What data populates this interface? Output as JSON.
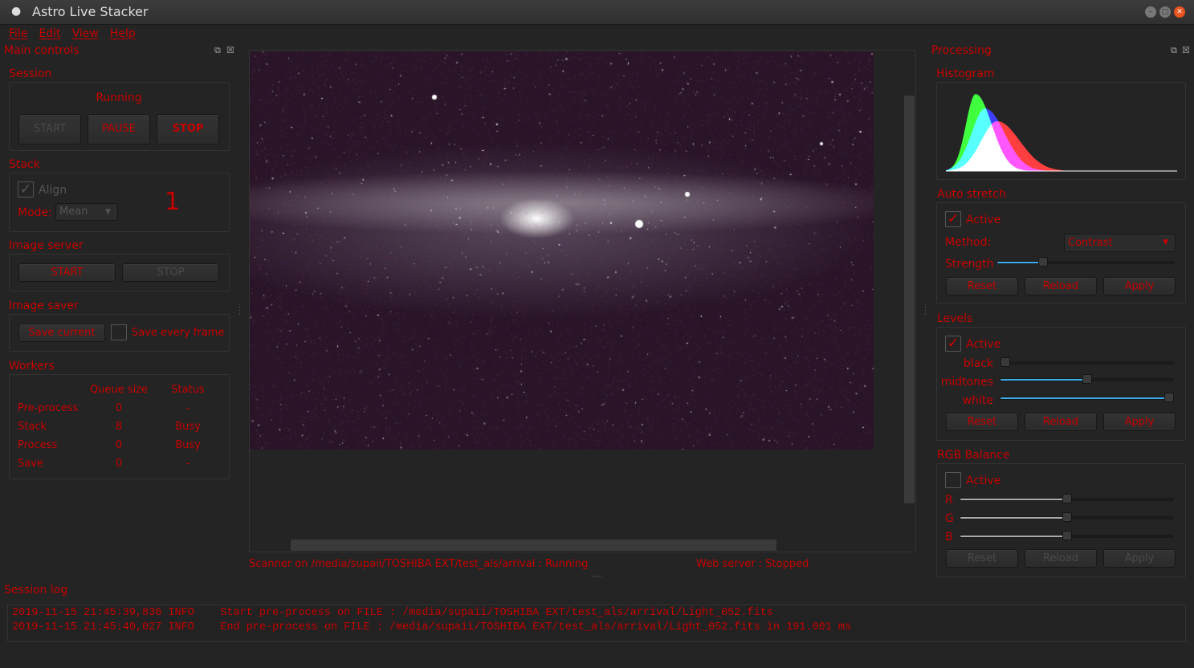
{
  "window": {
    "title": "Astro Live Stacker"
  },
  "menu": [
    "File",
    "Edit",
    "View",
    "Help"
  ],
  "main_controls": {
    "title": "Main controls",
    "session": {
      "label": "Session",
      "status": "Running",
      "start": "START",
      "pause": "PAUSE",
      "stop": "STOP"
    },
    "stack": {
      "label": "Stack",
      "align_label": "Align",
      "align_checked": true,
      "mode_label": "Mode:",
      "mode_value": "Mean",
      "count": "1"
    },
    "image_server": {
      "label": "Image server",
      "start": "START",
      "stop": "STOP"
    },
    "image_saver": {
      "label": "Image saver",
      "save_current": "Save current",
      "save_every_frame": "Save every frame",
      "save_every_frame_checked": false
    },
    "workers": {
      "label": "Workers",
      "headers": [
        "Queue size",
        "Status"
      ],
      "rows": [
        {
          "name": "Pre-process",
          "queue": "0",
          "status": "-"
        },
        {
          "name": "Stack",
          "queue": "8",
          "status": "Busy"
        },
        {
          "name": "Process",
          "queue": "0",
          "status": "Busy"
        },
        {
          "name": "Save",
          "queue": "0",
          "status": "-"
        }
      ]
    }
  },
  "status": {
    "scanner": "Scanner on /media/supaii/TOSHIBA EXT/test_als/arrival : Running",
    "web_server": "Web server : Stopped"
  },
  "processing": {
    "title": "Processing",
    "histogram": {
      "label": "Histogram",
      "channel_colors": {
        "r": "#ff2020",
        "g": "#20ff20",
        "b": "#2020ff"
      }
    },
    "auto_stretch": {
      "label": "Auto stretch",
      "active_label": "Active",
      "active": true,
      "method_label": "Method:",
      "method_value": "Contrast",
      "strength_label": "Strength",
      "strength": 0.26,
      "reset": "Reset",
      "reload": "Reload",
      "apply": "Apply"
    },
    "levels": {
      "label": "Levels",
      "active_label": "Active",
      "active": true,
      "black_label": "black",
      "black": 0.0,
      "midtones_label": "midtones",
      "midtones": 0.5,
      "white_label": "white",
      "white": 1.0,
      "reset": "Reset",
      "reload": "Reload",
      "apply": "Apply"
    },
    "rgb_balance": {
      "label": "RGB Balance",
      "active_label": "Active",
      "active": false,
      "r_label": "R",
      "r": 0.5,
      "g_label": "G",
      "g": 0.5,
      "b_label": "B",
      "b": 0.5,
      "reset": "Reset",
      "reload": "Reload",
      "apply": "Apply"
    }
  },
  "session_log": {
    "label": "Session log",
    "lines": [
      {
        "time": "2019-11-15 21:45:39,836",
        "level": "INFO",
        "msg": "Start pre-process on FILE : /media/supaii/TOSHIBA EXT/test_als/arrival/Light_052.fits"
      },
      {
        "time": "2019-11-15 21:45:40,027",
        "level": "INFO",
        "msg": "End pre-process on FILE : /media/supaii/TOSHIBA EXT/test_als/arrival/Light_052.fits in 191.001 ms"
      }
    ]
  }
}
